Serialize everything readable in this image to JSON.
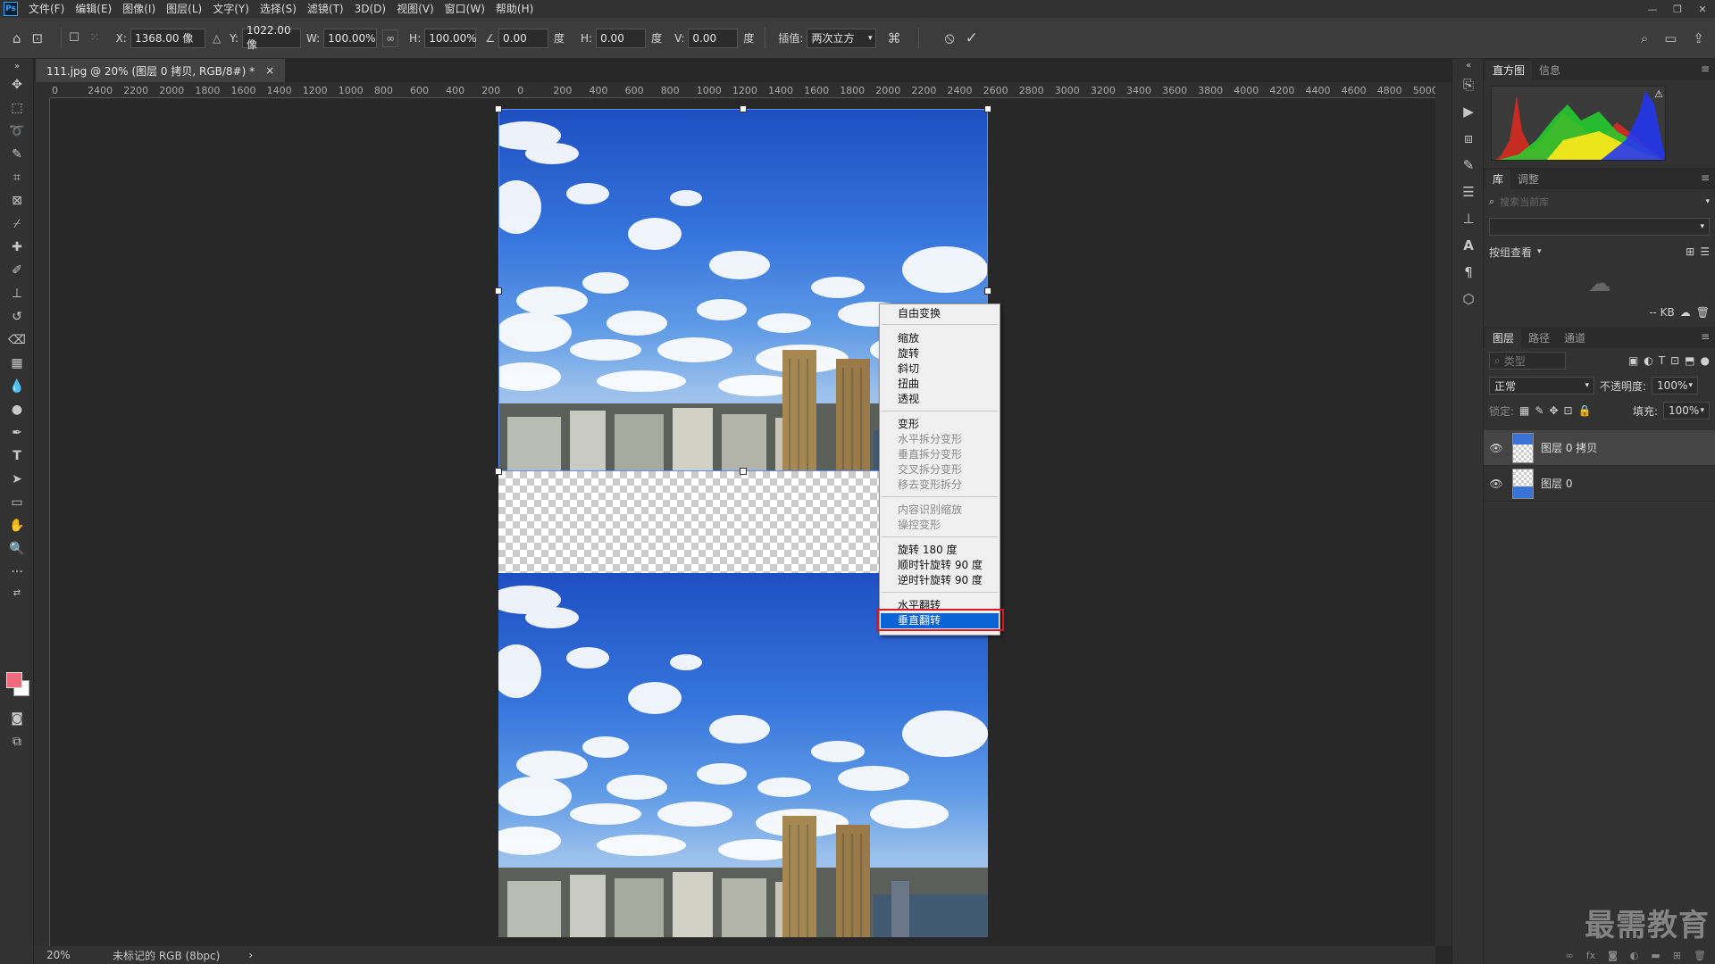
{
  "menubar": {
    "logo": "Ps",
    "items": [
      "文件(F)",
      "编辑(E)",
      "图像(I)",
      "图层(L)",
      "文字(Y)",
      "选择(S)",
      "滤镜(T)",
      "3D(D)",
      "视图(V)",
      "窗口(W)",
      "帮助(H)"
    ]
  },
  "options": {
    "x_label": "X:",
    "x_value": "1368.00 像",
    "y_label": "Y:",
    "y_value": "1022.00 像",
    "w_label": "W:",
    "w_value": "100.00%",
    "h_label": "H:",
    "h_value": "100.00%",
    "angle_value": "0.00",
    "angle_unit": "度",
    "skew_h_label": "H:",
    "skew_h_value": "0.00",
    "skew_h_unit": "度",
    "skew_v_label": "V:",
    "skew_v_value": "0.00",
    "skew_v_unit": "度",
    "interp_label": "插值:",
    "interp_value": "两次立方"
  },
  "document": {
    "tab_title": "111.jpg @ 20% (图层 0 拷贝, RGB/8#) *",
    "tab_close": "×"
  },
  "ruler": {
    "labels": [
      "0",
      "2400",
      "2200",
      "2000",
      "1800",
      "1600",
      "1400",
      "1200",
      "1000",
      "800",
      "600",
      "400",
      "200",
      "0",
      "200",
      "400",
      "600",
      "800",
      "1000",
      "1200",
      "1400",
      "1600",
      "1800",
      "2000",
      "2200",
      "2400",
      "2600",
      "2800",
      "3000",
      "3200",
      "3400",
      "3600",
      "3800",
      "4000",
      "4200",
      "4400",
      "4600",
      "4800",
      "5000",
      "5"
    ]
  },
  "context_menu": {
    "free_transform": "自由变换",
    "scale": "缩放",
    "rotate": "旋转",
    "skew": "斜切",
    "distort": "扭曲",
    "perspective": "透视",
    "warp": "变形",
    "split_h": "水平拆分变形",
    "split_v": "垂直拆分变形",
    "split_cross": "交叉拆分变形",
    "remove_split": "移去变形拆分",
    "content_aware": "内容识别缩放",
    "puppet": "操控变形",
    "rotate180": "旋转 180 度",
    "rotate_cw": "顺时针旋转 90 度",
    "rotate_ccw": "逆时针旋转 90 度",
    "flip_h": "水平翻转",
    "flip_v": "垂直翻转"
  },
  "status": {
    "zoom": "20%",
    "profile": "未标记的 RGB (8bpc)",
    "arrow": "›"
  },
  "panels": {
    "histogram_tab": "直方图",
    "info_tab": "信息",
    "library_tab": "库",
    "adjust_tab": "调整",
    "search_placeholder": "搜索当前库",
    "group_view": "按组查看",
    "size_text": "-- KB",
    "layers_tab": "图层",
    "paths_tab": "路径",
    "channels_tab": "通道",
    "kind_placeholder": "类型",
    "blend_mode": "正常",
    "opacity_label": "不透明度:",
    "opacity_value": "100%",
    "lock_label": "锁定:",
    "fill_label": "填充:",
    "fill_value": "100%",
    "layers": [
      {
        "name": "图层 0 拷贝",
        "selected": true
      },
      {
        "name": "图层 0",
        "selected": false
      }
    ]
  },
  "watermark": "最需教育",
  "colors": {
    "accent": "#0a64d6",
    "highlight_border": "#e0141e",
    "foreground": "#ef6a7a",
    "background": "#ffffff"
  }
}
